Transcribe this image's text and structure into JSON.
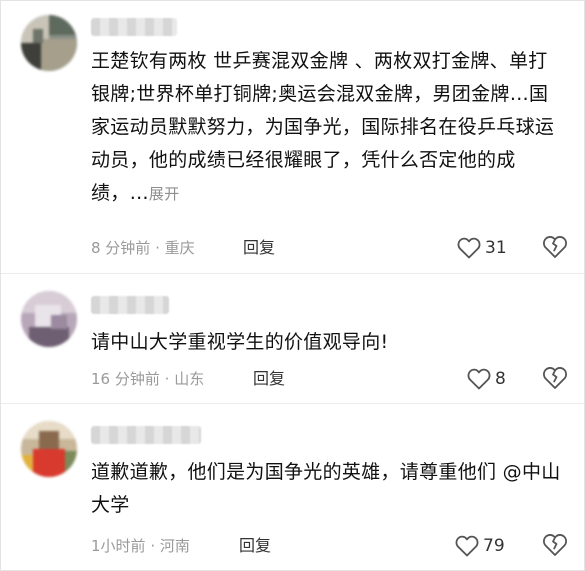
{
  "comments": [
    {
      "avatar": "blurred-avatar",
      "username": "",
      "text": "王楚钦有两枚 世乒赛混双金牌 、两枚双打金牌、单打银牌;世界杯单打铜牌;奥运会混双金牌，男团金牌…国家运动员默默努力，为国争光，国际排名在役乒乓球运动员，他的成绩已经很耀眼了，凭什么否定他的成绩，",
      "ellipsis": "…",
      "expand_label": "展开",
      "time": "8 分钟前",
      "separator": "·",
      "location": "重庆",
      "reply_label": "回复",
      "like_count": "31",
      "like_icon": "heart-outline-icon",
      "dislike_icon": "broken-heart-icon"
    },
    {
      "avatar": "blurred-avatar",
      "username": "",
      "text": "请中山大学重视学生的价值观导向!",
      "time": "16 分钟前",
      "separator": "·",
      "location": "山东",
      "reply_label": "回复",
      "like_count": "8",
      "like_icon": "heart-outline-icon",
      "dislike_icon": "broken-heart-icon"
    },
    {
      "avatar": "blurred-avatar",
      "username": "",
      "text": "道歉道歉，他们是为国争光的英雄，请尊重他们 @中山大学",
      "time": "1小时前",
      "separator": "·",
      "location": "河南",
      "reply_label": "回复",
      "like_count": "79",
      "like_icon": "heart-outline-icon",
      "dislike_icon": "broken-heart-icon"
    }
  ],
  "colors": {
    "text": "#111111",
    "meta": "#9a9a9a",
    "icon": "#555555",
    "divider": "#ececec"
  }
}
